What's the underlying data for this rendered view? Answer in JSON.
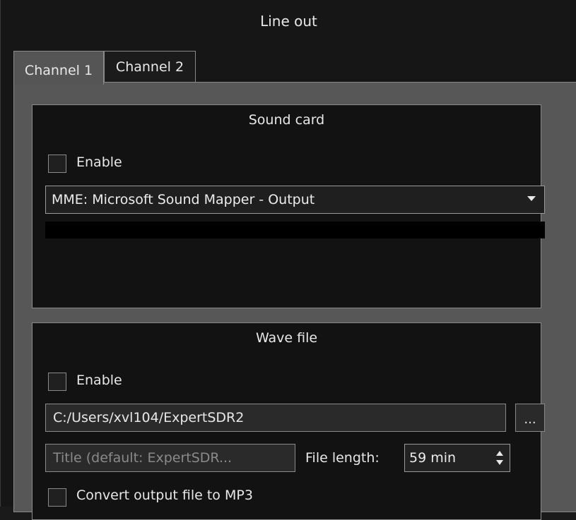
{
  "window": {
    "title": "Line out"
  },
  "tabs": [
    {
      "label": "Channel 1",
      "active": true
    },
    {
      "label": "Channel 2",
      "active": false
    }
  ],
  "sound_card": {
    "title": "Sound card",
    "enable_label": "Enable",
    "enable_checked": false,
    "device_selected": "MME: Microsoft Sound Mapper - Output"
  },
  "wave_file": {
    "title": "Wave file",
    "enable_label": "Enable",
    "enable_checked": false,
    "path_value": "C:/Users/xvl104/ExpertSDR2",
    "browse_label": "...",
    "title_placeholder": "Title (default: ExpertSDR...",
    "file_length_label": "File length:",
    "file_length_value": "59 min",
    "mp3_label": "Convert output file to MP3",
    "mp3_checked": false
  },
  "colors": {
    "background": "#161616",
    "panel": "#575757",
    "group": "#121212",
    "border": "#8a8a8a",
    "text": "#e8e8e8"
  }
}
